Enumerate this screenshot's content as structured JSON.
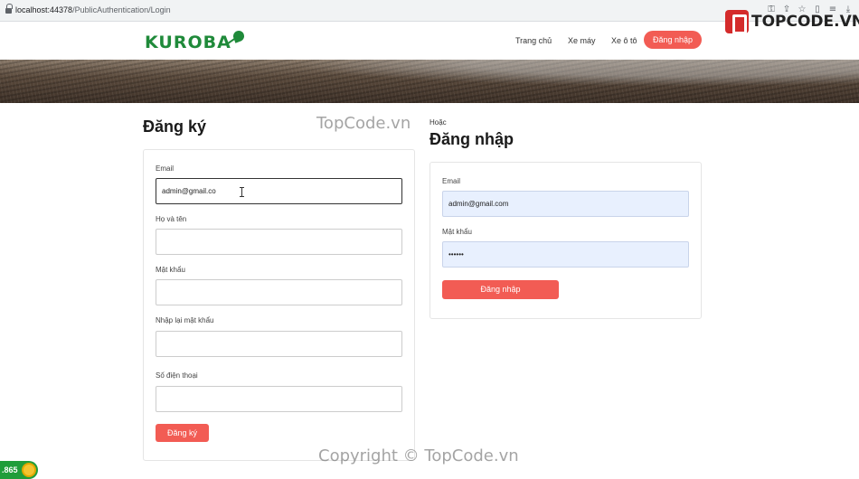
{
  "browser": {
    "url_host": "localhost:44378",
    "url_path": "/PublicAuthentication/Login",
    "icons": [
      "key-icon",
      "share-icon",
      "star-icon",
      "split-icon",
      "playlist-icon",
      "download-icon"
    ]
  },
  "watermark": {
    "top_text": "TopCode.vn",
    "bottom_text": "Copyright © TopCode.vn",
    "brand": "TOPCODE.VN"
  },
  "header": {
    "logo": "KUROBA",
    "nav": {
      "home": "Trang chủ",
      "motorbike": "Xe máy",
      "car": "Xe ô tô",
      "login": "Đăng nhập"
    }
  },
  "register": {
    "title": "Đăng ký",
    "email_label": "Email",
    "email_value": "admin@gmail.co",
    "fullname_label": "Họ và tên",
    "password_label": "Mật khẩu",
    "confirm_label": "Nhập lại mật khẩu",
    "phone_label": "Số điện thoại",
    "submit": "Đăng ký"
  },
  "login": {
    "or_text": "Hoặc",
    "title": "Đăng nhập",
    "email_label": "Email",
    "email_value": "admin@gmail.com",
    "password_label": "Mật khẩu",
    "password_value": "••••••",
    "submit": "Đăng nhập"
  },
  "widget": {
    "value": ".865"
  },
  "colors": {
    "accent": "#f25c54",
    "logo_green": "#1f8a3a",
    "autofill_bg": "#e8f0fe"
  }
}
